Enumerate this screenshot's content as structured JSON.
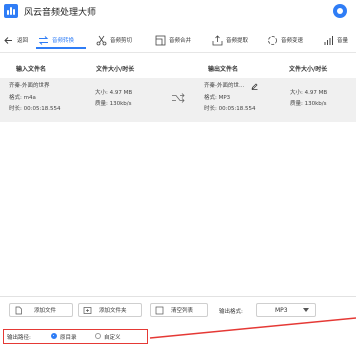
{
  "app": {
    "title": "风云音频处理大师"
  },
  "toolbar": {
    "back_label": "返回",
    "tabs": [
      {
        "label": "音频转换",
        "icon": "convert-icon",
        "active": true
      },
      {
        "label": "音频剪切",
        "icon": "scissors-icon"
      },
      {
        "label": "音频合并",
        "icon": "merge-icon"
      },
      {
        "label": "音频提取",
        "icon": "extract-icon"
      },
      {
        "label": "音频变速",
        "icon": "speed-icon"
      },
      {
        "label": "音量",
        "icon": "volume-icon"
      }
    ]
  },
  "table": {
    "headers": {
      "input_name": "输入文件名",
      "size_dur": "文件大小/时长",
      "output_name": "输出文件名",
      "size_dur_out": "文件大小/时长"
    },
    "row": {
      "input": {
        "name": "齐秦-外面的世界",
        "format": "格式:  m4a",
        "duration": "时长:  00:05:18.554"
      },
      "input_size": "大小:  4.97 MB",
      "input_quality": "质量:  130kb/s",
      "output": {
        "name": "齐秦-外面的世...",
        "format": "格式:  MP3",
        "duration": "时长:  00:05:18.554"
      },
      "output_size": "大小:  4.97 MB",
      "output_quality": "质量:  130kb/s"
    }
  },
  "bottom": {
    "add_file": "添加文件",
    "add_folder": "添加文件夹",
    "clear_list": "清空列表",
    "format_label": "输出格式:",
    "format_value": "MP3",
    "output_path_label": "输出路径:",
    "option_source": "原目录",
    "option_custom": "自定义"
  },
  "colors": {
    "accent": "#2f7df6",
    "highlight": "#e53935",
    "row_bg": "#f0f0f0"
  }
}
